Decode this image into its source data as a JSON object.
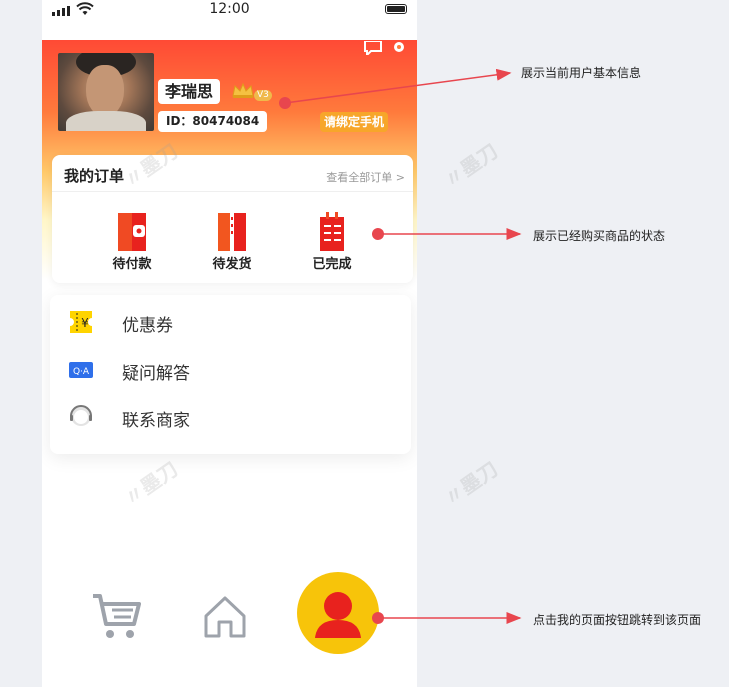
{
  "status_bar": {
    "time": "12:00"
  },
  "profile": {
    "name": "李瑞思",
    "level": "V3",
    "id_text": "ID：80474084",
    "bind_phone_label": "请绑定手机"
  },
  "orders": {
    "title": "我的订单",
    "view_all": "查看全部订单 >",
    "items": [
      {
        "label": "待付款"
      },
      {
        "label": "待发货"
      },
      {
        "label": "已完成"
      }
    ]
  },
  "menu": {
    "items": [
      {
        "label": "优惠券",
        "icon": "coupon-icon"
      },
      {
        "label": "疑问解答",
        "icon": "qa-icon"
      },
      {
        "label": "联系商家",
        "icon": "customer-service-icon"
      }
    ]
  },
  "tabbar": {
    "items": [
      {
        "name": "cart",
        "icon": "cart-icon"
      },
      {
        "name": "home",
        "icon": "home-icon"
      },
      {
        "name": "me",
        "icon": "user-icon",
        "active": true
      }
    ]
  },
  "annotations": {
    "user_info": "展示当前用户基本信息",
    "order_status": "展示已经购买商品的状态",
    "me_button": "点击我的页面按钮跳转到该页面"
  },
  "colors": {
    "header_top": "#ff4a35",
    "accent_yellow": "#f7c40a",
    "order_red": "#e8221e",
    "annotation_red": "#e8464e"
  }
}
